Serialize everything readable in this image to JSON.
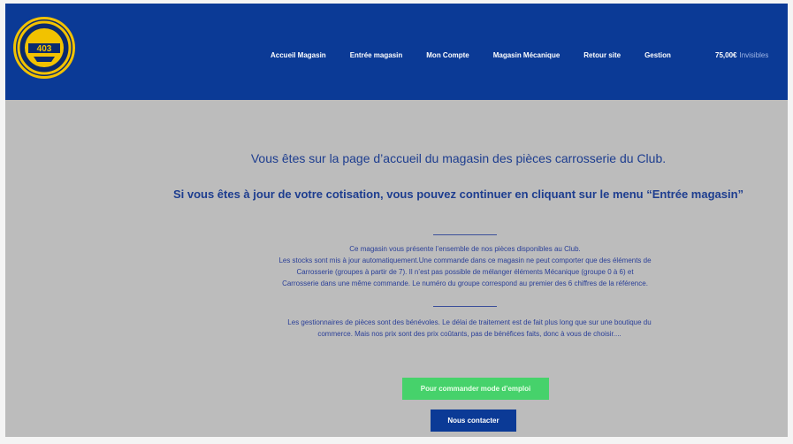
{
  "logo": {
    "text": "403"
  },
  "nav": {
    "items": [
      "Accueil Magasin",
      "Entrée magasin",
      "Mon Compte",
      "Magasin Mécanique",
      "Retour site",
      "Gestion"
    ]
  },
  "cart": {
    "amount": "75,00€",
    "label": "Invisibles"
  },
  "main": {
    "heading": "Vous êtes sur la page d’accueil du magasin des pièces carrosserie du Club.",
    "subheading": "Si vous êtes à jour de votre cotisation, vous pouvez continuer en cliquant sur le menu “Entrée magasin”",
    "paragraph1": [
      "Ce magasin vous présente l’ensemble de nos pièces disponibles au Club.",
      "Les stocks sont mis à jour automatiquement.Une commande dans ce magasin ne peut comporter que des éléments de",
      "Carrosserie (groupes à partir de 7). Il n’est pas possible de mélanger éléments Mécanique (groupe 0 à 6) et",
      "Carrosserie dans une même commande. Le numéro du groupe correspond au premier des 6 chiffres de la référence."
    ],
    "paragraph2": [
      "Les gestionnaires de pièces sont des bénévoles. Le délai de traitement est de fait plus long que sur une boutique du",
      "commerce. Mais nos prix sont des prix coûtants, pas de bénéfices faits, donc à vous de choisir...."
    ],
    "button_green": "Pour commander mode d’emploi",
    "button_blue": "Nous contacter"
  },
  "colors": {
    "header": "#0b3a96",
    "text": "#1d3d8f",
    "green": "#46d26b",
    "background": "#bcbcbc"
  }
}
